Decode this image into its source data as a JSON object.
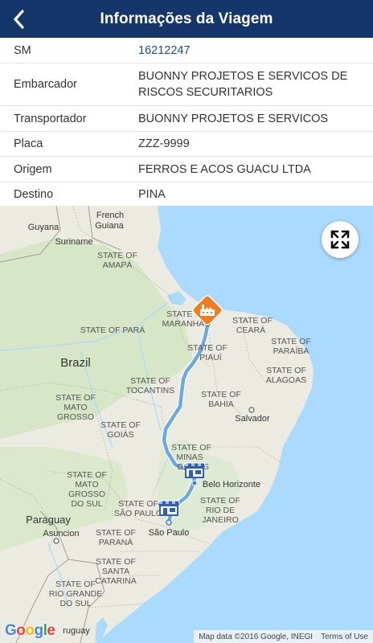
{
  "header": {
    "title": "Informações da Viagem"
  },
  "trip": [
    {
      "label": "SM",
      "value": "16212247",
      "is_link": true
    },
    {
      "label": "Embarcador",
      "value": "BUONNY PROJETOS E SERVICOS DE RISCOS SECURITARIOS"
    },
    {
      "label": "Transportador",
      "value": "BUONNY PROJETOS E SERVICOS"
    },
    {
      "label": "Placa",
      "value": "ZZZ-9999"
    },
    {
      "label": "Origem",
      "value": "FERROS E ACOS GUACU LTDA"
    },
    {
      "label": "Destino",
      "value": "PINA"
    }
  ],
  "map": {
    "labels": {
      "french_guiana_1": "French",
      "french_guiana_2": "Guiana",
      "guyana": "Guyana",
      "suriname": "Suriname",
      "amapa_1": "STATE OF",
      "amapa_2": "AMAPÁ",
      "para_1": "STATE OF PARÁ",
      "maranhao_1": "STATE OF",
      "maranhao_2": "MARANHÃO",
      "ceara_1": "STATE OF",
      "ceara_2": "CEARÁ",
      "piaui_1": "STATE OF",
      "piaui_2": "PIAUÍ",
      "paraiba_1": "STATE OF",
      "paraiba_2": "PARAÍBA",
      "alagoas_1": "STATE OF",
      "alagoas_2": "ALAGOAS",
      "brazil": "Brazil",
      "tocantins_1": "STATE OF",
      "tocantins_2": "TOCANTINS",
      "bahia_1": "STATE OF",
      "bahia_2": "BAHIA",
      "mato_grosso_1": "STATE OF",
      "mato_grosso_2": "MATO",
      "mato_grosso_3": "GROSSO",
      "goias_1": "STATE OF",
      "goias_2": "GOIÁS",
      "salvador": "Salvador",
      "minas_1": "STATE OF",
      "minas_2": "MINAS",
      "minas_3": "GERAIS",
      "belo_horizonte": "Belo Horizonte",
      "ms_1": "STATE OF",
      "ms_2": "MATO",
      "ms_3": "GROSSO",
      "ms_4": "DO SUL",
      "sao_paulo_state_1": "STATE OF",
      "sao_paulo_state_2": "SÃO PAULO",
      "rio_1": "STATE OF",
      "rio_2": "RIO DE",
      "rio_3": "JANEIRO",
      "paraguay": "Paraguay",
      "asuncion": "Asuncion",
      "sao_paulo_city": "São Paulo",
      "parana_1": "STATE OF",
      "parana_2": "PARANÁ",
      "santa_catarina_1": "STATE OF",
      "santa_catarina_2": "SANTA",
      "santa_catarina_3": "CATARINA",
      "rgs_1": "STATE OF",
      "rgs_2": "RIO GRANDE",
      "rgs_3": "DO SUL",
      "uruguay": "ruguay"
    },
    "attribution_data": "Map data ©2016 Google, INEGI",
    "attribution_terms": "Terms of Use",
    "google_logo": [
      "G",
      "o",
      "o",
      "g",
      "l",
      "e"
    ],
    "colors": {
      "land": "#ecebe1",
      "forest": "#d5e6c4",
      "water": "#aadaff",
      "route": "#6da9e0",
      "origin_marker": "#f47b20",
      "store_marker": "#2f5fb3"
    }
  },
  "icons": {
    "back": "chevron-left-icon",
    "fullscreen": "expand-icon",
    "origin": "factory-icon",
    "waypoint": "store-icon"
  }
}
